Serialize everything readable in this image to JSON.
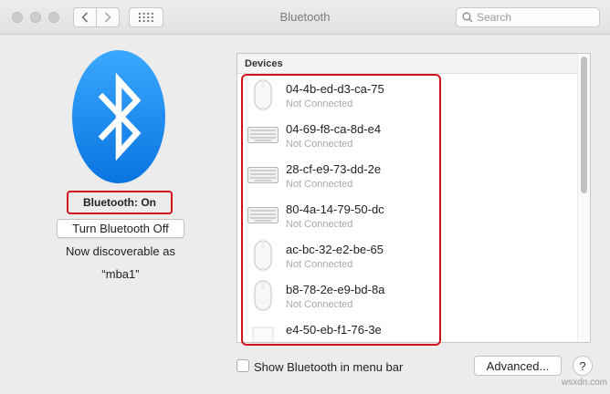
{
  "window": {
    "title": "Bluetooth",
    "search_placeholder": "Search"
  },
  "left_panel": {
    "status": "Bluetooth: On",
    "toggle_label": "Turn Bluetooth Off",
    "discoverable_line1": "Now discoverable as",
    "discoverable_name": "“mba1”"
  },
  "devices": {
    "header": "Devices",
    "items": [
      {
        "name": "04-4b-ed-d3-ca-75",
        "status": "Not Connected",
        "icon": "mouse-icon"
      },
      {
        "name": "04-69-f8-ca-8d-e4",
        "status": "Not Connected",
        "icon": "keyboard-icon"
      },
      {
        "name": "28-cf-e9-73-dd-2e",
        "status": "Not Connected",
        "icon": "keyboard-icon"
      },
      {
        "name": "80-4a-14-79-50-dc",
        "status": "Not Connected",
        "icon": "keyboard-icon"
      },
      {
        "name": "ac-bc-32-e2-be-65",
        "status": "Not Connected",
        "icon": "mouse-icon"
      },
      {
        "name": "b8-78-2e-e9-bd-8a",
        "status": "Not Connected",
        "icon": "mouse-icon"
      },
      {
        "name": "e4-50-eb-f1-76-3e",
        "status": "",
        "icon": "device-icon"
      }
    ]
  },
  "bottom": {
    "show_in_menu_bar_label": "Show Bluetooth in menu bar",
    "advanced_label": "Advanced...",
    "help_label": "?"
  },
  "watermark": "wsxdn.com",
  "colors": {
    "bluetooth_blue": "#1a8cf2",
    "highlight_red": "#d3131b"
  }
}
